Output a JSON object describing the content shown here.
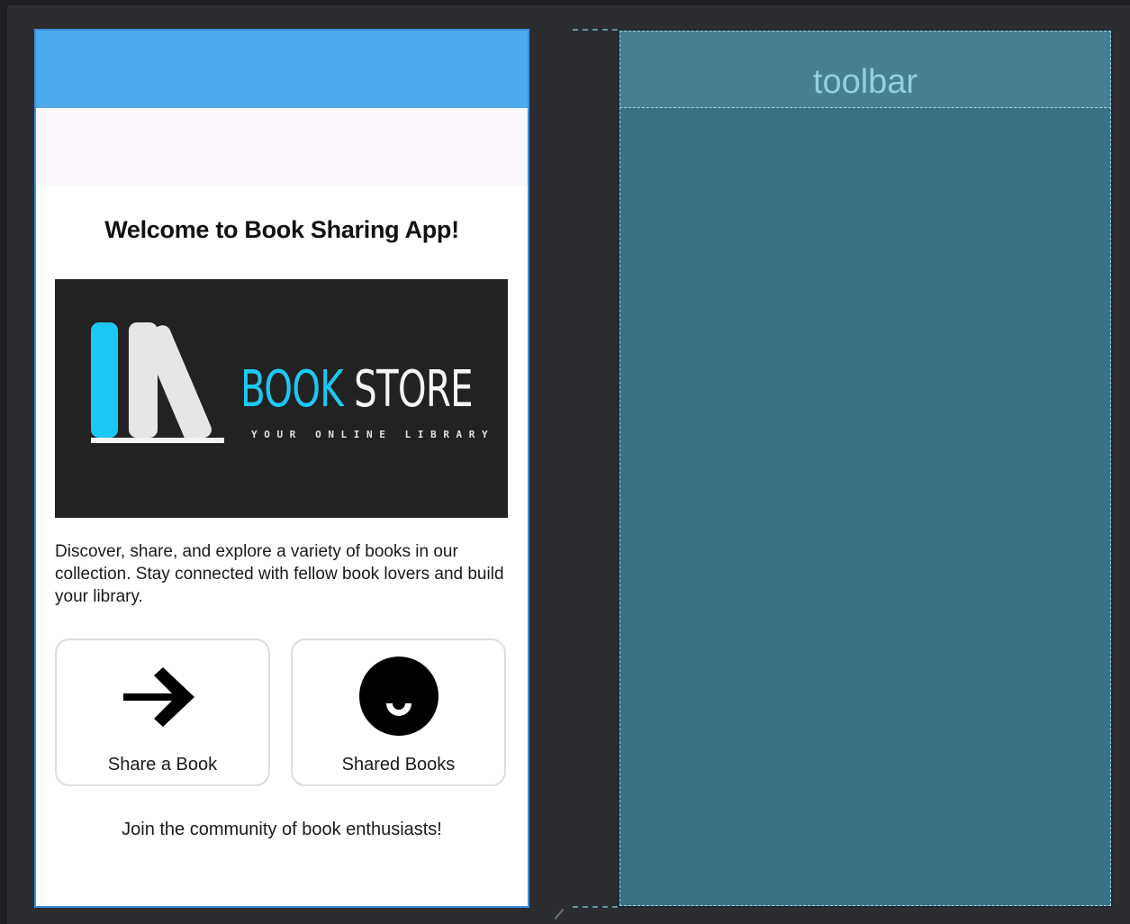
{
  "design": {
    "welcome_title": "Welcome to Book Sharing App!",
    "logo": {
      "word_1": "BOOK",
      "word_2": " STORE",
      "tagline": "YOUR ONLINE LIBRARY"
    },
    "description": "Discover, share, and explore a variety of books in our collection. Stay connected with fellow book lovers and build your library.",
    "cards": [
      {
        "label": "Share a Book",
        "icon": "arrow-right-icon"
      },
      {
        "label": "Shared Books",
        "icon": "smile-face-icon"
      }
    ],
    "footer": "Join the community of book enthusiasts!"
  },
  "blueprint": {
    "toolbar_label": "toolbar"
  },
  "colors": {
    "status_bar": "#4eabeb",
    "toolbar_bg": "#fdf6fd",
    "logo_bg": "#222222",
    "logo_accent": "#1cc8f2",
    "blueprint_bg": "#397187",
    "blueprint_toolbar": "#467f93",
    "blueprint_text": "#8fd0e2"
  }
}
